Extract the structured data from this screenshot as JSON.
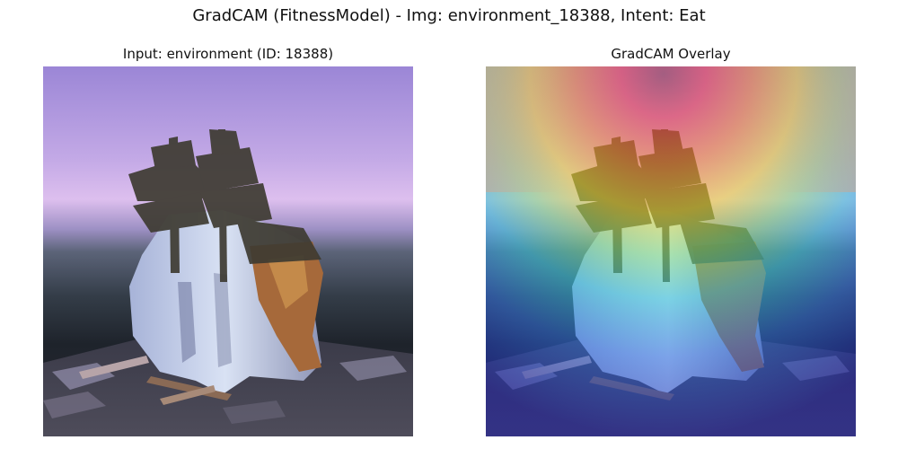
{
  "figure": {
    "suptitle": "GradCAM (FitnessModel) - Img: environment_18388, Intent: Eat"
  },
  "panels": [
    {
      "title": "Input: environment (ID: 18388)",
      "image": "photo of a rocky islet with pine trees on a frozen lake at dusk"
    },
    {
      "title": "GradCAM Overlay",
      "image": "same photo with jet-colormap heatmap overlay, warm colors concentrated in upper-center around trees",
      "colormap": "jet"
    }
  ]
}
